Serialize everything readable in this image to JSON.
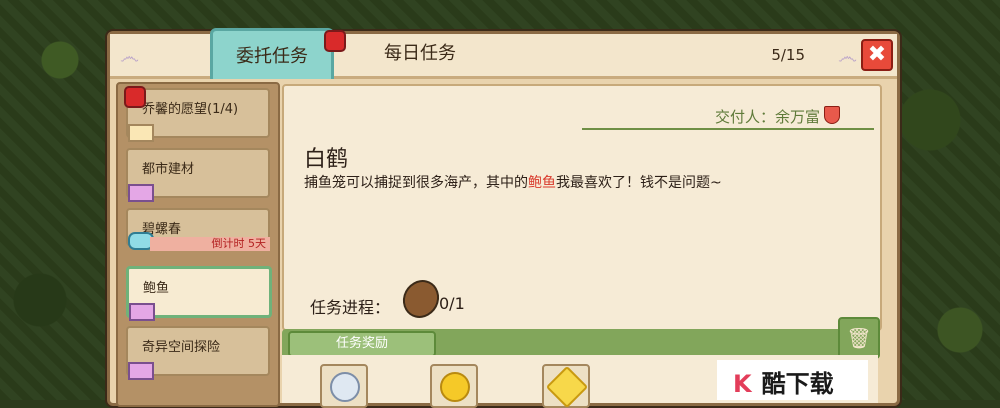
{
  "tabs": {
    "commission": "委托任务",
    "daily": "每日任务"
  },
  "count": "5/15",
  "close_label": "✖",
  "quests": [
    {
      "label": "乔馨的愿望(1/4)"
    },
    {
      "label": "都市建材"
    },
    {
      "label": "碧螺春",
      "timer": "倒计时 5天"
    },
    {
      "label": "鲍鱼"
    },
    {
      "label": "奇异空间探险"
    }
  ],
  "detail": {
    "giver": "交付人：余万富",
    "title": "白鹤",
    "desc_pre": "捕鱼笼可以捕捉到很多海产，其中的",
    "desc_hl": "鲍鱼",
    "desc_post": "我最喜欢了！钱不是问题~",
    "progress_label": "任务进程：",
    "progress_value": "0/1"
  },
  "reward_label": "任务奖励",
  "trash_icon": "trash-icon",
  "watermark": {
    "logo": "K",
    "text": "酷下载"
  },
  "colors": {
    "accent": "#8dd4cc",
    "panel": "#e9d3ad",
    "highlight": "#d9382a",
    "green": "#82a65b"
  }
}
